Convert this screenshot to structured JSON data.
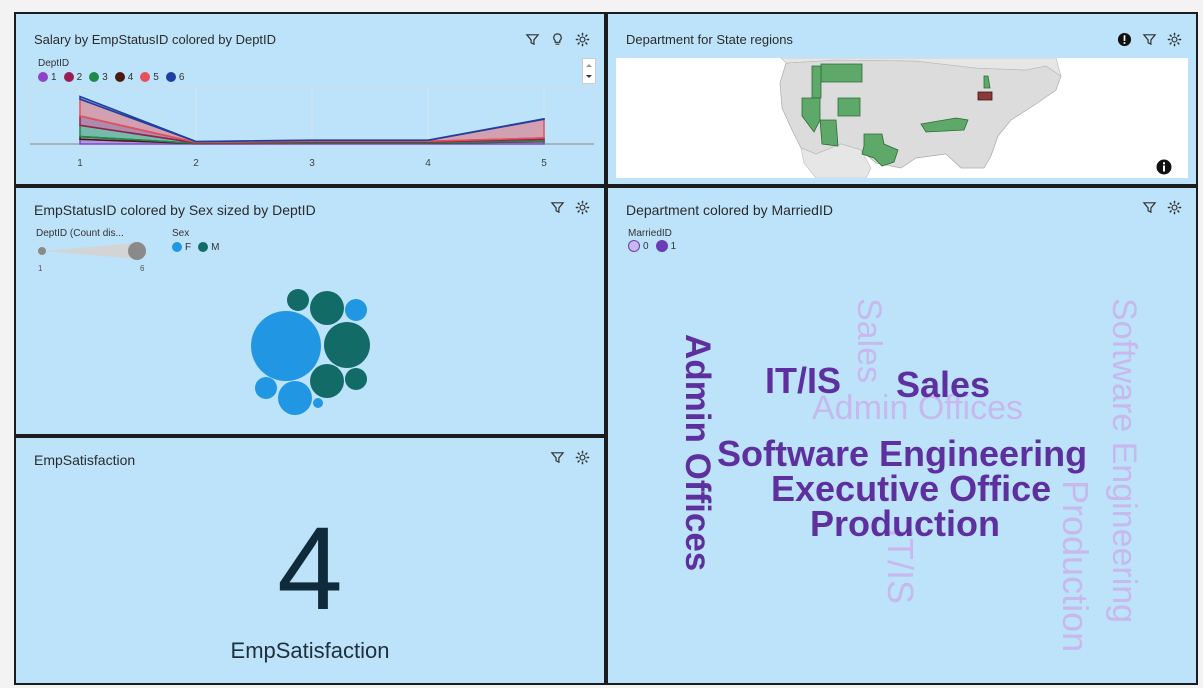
{
  "panels": {
    "salary": {
      "title": "Salary by EmpStatusID colored by DeptID",
      "legend_title": "DeptID",
      "legend": [
        {
          "label": "1",
          "color": "#8e44c6"
        },
        {
          "label": "2",
          "color": "#9b1d50"
        },
        {
          "label": "3",
          "color": "#1e8a4a"
        },
        {
          "label": "4",
          "color": "#4a1a10"
        },
        {
          "label": "5",
          "color": "#e8505b"
        },
        {
          "label": "6",
          "color": "#1f3fa0"
        }
      ]
    },
    "department_map": {
      "title": "Department for State regions"
    },
    "bubble": {
      "title": "EmpStatusID colored by Sex sized by DeptID",
      "size_legend_title": "DeptID (Count dis...",
      "size_min": "1",
      "size_max": "6",
      "color_legend_title": "Sex",
      "color_legend": [
        {
          "label": "F",
          "color": "#2196e3"
        },
        {
          "label": "M",
          "color": "#136b68"
        }
      ]
    },
    "wordcloud": {
      "title": "Department colored by MarriedID",
      "legend_title": "MarriedID",
      "legend": [
        {
          "label": "0",
          "color": "#c7b8ee"
        },
        {
          "label": "1",
          "color": "#6a3cb6"
        }
      ],
      "words": {
        "admin_offices_1": "Admin Offices",
        "it_is_1": "IT/IS",
        "sales_1": "Sales",
        "software_engineering_1": "Software Engineering",
        "executive_office_1": "Executive Office",
        "production_1": "Production",
        "sales_0": "Sales",
        "admin_offices_0": "Admin Offices",
        "it_is_0": "IT/IS",
        "production_0": "Production",
        "software_engineering_0": "Software Engineering"
      }
    },
    "satisfaction": {
      "title": "EmpSatisfaction",
      "value": "4",
      "label": "EmpSatisfaction"
    }
  },
  "chart_data": {
    "type": "area",
    "x": [
      1,
      2,
      3,
      4,
      5
    ],
    "xlabel": "",
    "ylabel": "",
    "series": [
      {
        "name": "1",
        "values": [
          5,
          0.5,
          0.8,
          0.8,
          2.5
        ]
      },
      {
        "name": "2",
        "values": [
          10,
          0.5,
          0.8,
          0.8,
          1.5
        ]
      },
      {
        "name": "3",
        "values": [
          12,
          0.5,
          1,
          1,
          2
        ]
      },
      {
        "name": "4",
        "values": [
          3,
          0.2,
          0.3,
          0.3,
          0.5
        ]
      },
      {
        "name": "5",
        "values": [
          18,
          0.8,
          1,
          1,
          20
        ]
      },
      {
        "name": "6",
        "values": [
          3,
          0.2,
          0.3,
          0.3,
          0.5
        ]
      }
    ],
    "ylim": [
      0,
      60
    ],
    "grid": true,
    "legend_position": "top-left"
  }
}
